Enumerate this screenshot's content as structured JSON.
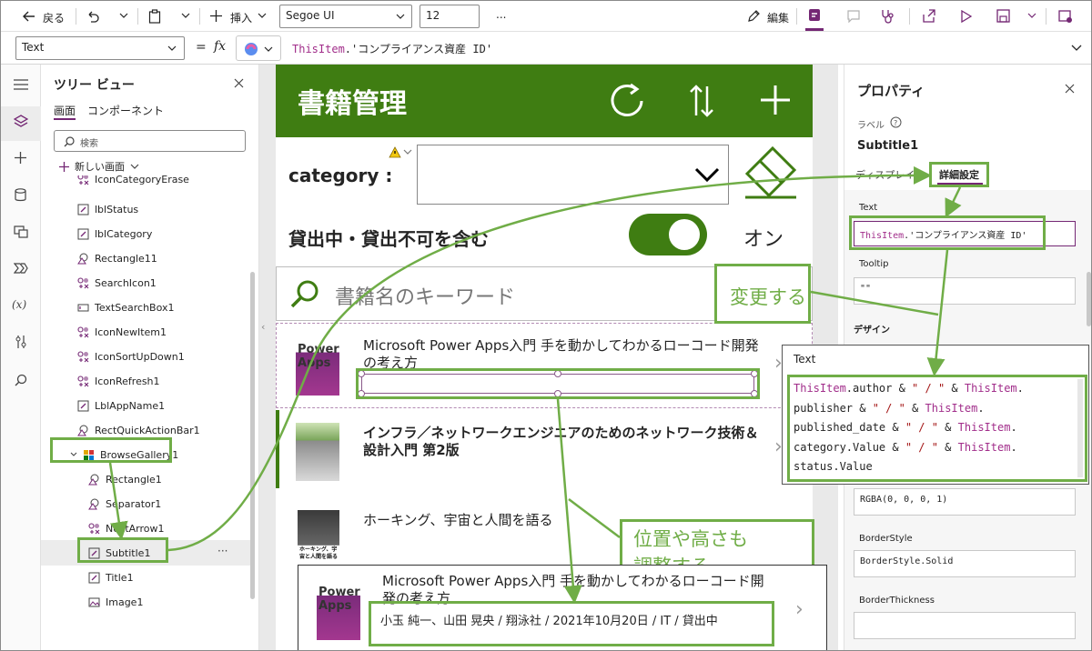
{
  "toolbar": {
    "back": "戻る",
    "insert": "挿入",
    "font": "Segoe UI",
    "size": "12",
    "more": "...",
    "edit": "編集"
  },
  "formula": {
    "property": "Text",
    "equals": "=",
    "fx": "fx",
    "expr_item": "ThisItem",
    "expr_rest": ".'コンプライアンス資産 ID'"
  },
  "tree": {
    "title": "ツリー ビュー",
    "tab_screens": "画面",
    "tab_components": "コンポーネント",
    "search_placeholder": "検索",
    "new_screen": "新しい画面",
    "items": [
      {
        "label": "IconCategoryErase"
      },
      {
        "label": "lblStatus"
      },
      {
        "label": "lblCategory"
      },
      {
        "label": "Rectangle11"
      },
      {
        "label": "SearchIcon1"
      },
      {
        "label": "TextSearchBox1"
      },
      {
        "label": "IconNewItem1"
      },
      {
        "label": "IconSortUpDown1"
      },
      {
        "label": "IconRefresh1"
      },
      {
        "label": "LblAppName1"
      },
      {
        "label": "RectQuickActionBar1"
      },
      {
        "label": "BrowseGallery1"
      },
      {
        "label": "Rectangle1"
      },
      {
        "label": "Separator1"
      },
      {
        "label": "NextArrow1"
      },
      {
        "label": "Subtitle1"
      },
      {
        "label": "Title1"
      },
      {
        "label": "Image1"
      }
    ],
    "more": "···"
  },
  "app": {
    "title": "書籍管理",
    "category_label": "category :",
    "toggle_label": "貸出中・貸出不可を含む",
    "toggle_state": "オン",
    "search_placeholder": "書籍名のキーワード",
    "rows": [
      {
        "title": "Microsoft Power Apps入門 手を動かしてわかるローコード開発の考え方",
        "cover": "Power Apps"
      },
      {
        "title": "インフラ／ネットワークエンジニアのためのネットワーク技術＆設計入門 第2版",
        "cover": ""
      },
      {
        "title": "ホーキング、宇宙と人間を語る",
        "cover": "ホーキング、宇宙と人間を語る"
      }
    ]
  },
  "props": {
    "title": "プロパティ",
    "label": "ラベル",
    "name": "Subtitle1",
    "tab_display": "ディスプレイ",
    "tab_advanced": "詳細設定",
    "text_label": "Text",
    "text_item": "ThisItem",
    "text_rest": ".'コンプライアンス資産 ID'",
    "tooltip_label": "Tooltip",
    "tooltip_value": "\"\"",
    "design_label": "デザイン",
    "color_value": "RGBA(0, 0, 0, 1)",
    "borderstyle_label": "BorderStyle",
    "borderstyle_value": "BorderStyle.Solid",
    "borderthickness_label": "BorderThickness"
  },
  "annotations": {
    "change": "変更する",
    "adjust_line1": "位置や高さも",
    "adjust_line2": "調整する",
    "text_popup_title": "Text",
    "formula_lines": [
      [
        "ThisItem",
        ".author & ",
        "\" / \"",
        " & ",
        "ThisItem",
        "."
      ],
      [
        "publisher & ",
        "\" / \"",
        " & ",
        "ThisItem",
        "."
      ],
      [
        "published_date & ",
        "\" / \"",
        " & ",
        "ThisItem",
        "."
      ],
      [
        "category.Value & ",
        "\" / \"",
        " & ",
        "ThisItem",
        "."
      ],
      [
        "status.Value"
      ]
    ],
    "result_title": "Microsoft Power Apps入門 手を動かしてわかるローコード開発の考え方",
    "result_subtitle": "小玉 純一、山田 晃央 / 翔泳社 / 2021年10月20日 / IT / 貸出中",
    "cover_text": "Power Apps"
  },
  "colors": {
    "accent": "#742774",
    "app_green": "#3f7d12",
    "annotation_green": "#70ad47"
  }
}
